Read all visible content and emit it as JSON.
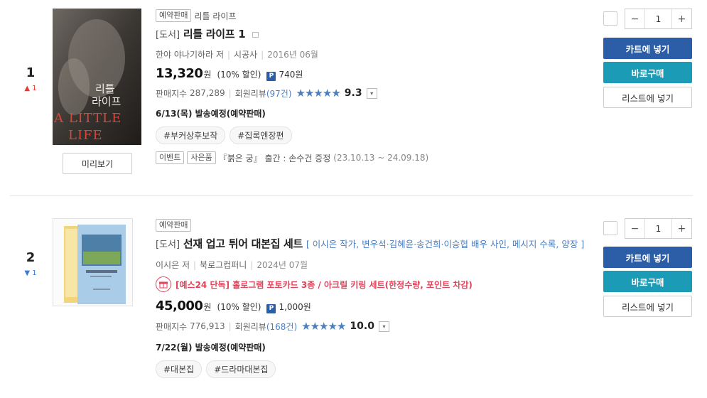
{
  "items": [
    {
      "rank": "1",
      "rank_change": "1",
      "rank_direction": "up",
      "cover": {
        "title_ko_1": "리틀",
        "title_ko_2": "라이프",
        "title_en_1": "A LITTLE",
        "title_en_2": "LIFE"
      },
      "preview_label": "미리보기",
      "badge": "예약판매",
      "series": "리틀 라이프",
      "category": "[도서]",
      "title": "리틀 라이프 1",
      "author": "한야 야나기하라",
      "author_role": "저",
      "publisher": "시공사",
      "pub_date": "2016년 06월",
      "price": "13,320",
      "won": "원",
      "discount": "(10% 할인)",
      "point_icon": "P",
      "points": "740원",
      "sales_label": "판매지수",
      "sales_index": "287,289",
      "review_label": "회원리뷰",
      "review_count": "(97건)",
      "stars": "★★★★★",
      "rating": "9.3",
      "shipping": "6/13(목) 발송예정(예약판매)",
      "hashtags": [
        "#부커상후보작",
        "#집록엔장편"
      ],
      "event_tags": [
        "이벤트",
        "사은품"
      ],
      "event_text": "『붉은 궁』 출간 : 손수건 증정",
      "event_period": "(23.10.13 ~ 24.09.18)",
      "qty": "1",
      "btn_cart": "카트에 넣기",
      "btn_buy": "바로구매",
      "btn_list": "리스트에 넣기"
    },
    {
      "rank": "2",
      "rank_change": "1",
      "rank_direction": "down",
      "badge": "예약판매",
      "category": "[도서]",
      "title": "선재 업고 튀어 대본집 세트",
      "subtitle": "[ 이시은 작가, 변우석·김혜윤·송건희·이승협 배우 사인, 메시지 수록, 양장 ]",
      "author": "이시은",
      "author_role": "저",
      "publisher": "북로그컴퍼니",
      "pub_date": "2024년 07월",
      "promo": "[예스24 단독] 홀로그램 포토카드 3종 / 아크릴 키링 세트(한정수량, 포인트 차감)",
      "price": "45,000",
      "won": "원",
      "discount": "(10% 할인)",
      "point_icon": "P",
      "points": "1,000원",
      "sales_label": "판매지수",
      "sales_index": "776,913",
      "review_label": "회원리뷰",
      "review_count": "(168건)",
      "stars": "★★★★★",
      "rating": "10.0",
      "shipping": "7/22(월) 발송예정(예약판매)",
      "hashtags": [
        "#대본집",
        "#드라마대본집"
      ],
      "qty": "1",
      "btn_cart": "카트에 넣기",
      "btn_buy": "바로구매",
      "btn_list": "리스트에 넣기"
    }
  ],
  "icons": {
    "up": "arrow-up-icon",
    "down": "arrow-down-icon",
    "minus": "−",
    "plus": "+",
    "chevron": "▾"
  },
  "colors": {
    "cart": "#2b5ea7",
    "buy": "#1b9bb5",
    "link": "#4a7fc0",
    "promo": "#e0435a"
  }
}
